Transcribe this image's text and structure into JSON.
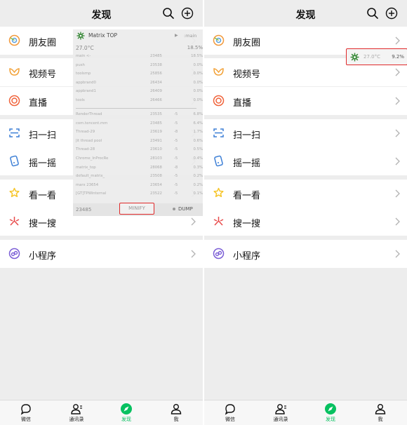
{
  "title": "发现",
  "items": [
    {
      "label": "朋友圈",
      "icon": "moments-icon",
      "color": "#f2993b"
    },
    {
      "label": "视频号",
      "icon": "channels-icon",
      "color": "#f2a137"
    },
    {
      "label": "直播",
      "icon": "live-icon",
      "color": "#f0643c"
    },
    {
      "label": "扫一扫",
      "icon": "scan-icon",
      "color": "#3d7fd6"
    },
    {
      "label": "摇一摇",
      "icon": "shake-icon",
      "color": "#3d7fd6"
    },
    {
      "label": "看一看",
      "icon": "top-stories-icon",
      "color": "#f6c52a"
    },
    {
      "label": "搜一搜",
      "icon": "search-feature-icon",
      "color": "#e84b4b"
    },
    {
      "label": "小程序",
      "icon": "mini-programs-icon",
      "color": "#7b5ed6"
    }
  ],
  "tabs": [
    {
      "label": "微信",
      "icon": "chats-icon"
    },
    {
      "label": "通讯录",
      "icon": "contacts-icon"
    },
    {
      "label": "发现",
      "icon": "discover-icon"
    },
    {
      "label": "我",
      "icon": "me-icon"
    }
  ],
  "active_tab": "发现",
  "overlay": {
    "title": "Matrix TOP",
    "process": ":main",
    "temperature": "27.0°C",
    "cpu_total": "18.5%",
    "threads": [
      {
        "name": "main <-",
        "pid": "23485",
        "nice": "",
        "cpu": "18.5%"
      },
      {
        "name": "push",
        "pid": "23538",
        "nice": "",
        "cpu": "0.0%"
      },
      {
        "name": "toolsmp",
        "pid": "25856",
        "nice": "",
        "cpu": "0.0%"
      },
      {
        "name": "appbrand0",
        "pid": "26434",
        "nice": "",
        "cpu": "0.0%"
      },
      {
        "name": "appbrand1",
        "pid": "26409",
        "nice": "",
        "cpu": "0.0%"
      },
      {
        "name": "tools",
        "pid": "26466",
        "nice": "",
        "cpu": "0.0%"
      },
      {
        "name": "RenderThread",
        "pid": "23535",
        "nice": "-5",
        "cpu": "6.8%"
      },
      {
        "name": "com.tencent.mm",
        "pid": "23485",
        "nice": "-5",
        "cpu": "6.4%"
      },
      {
        "name": "Thread-29",
        "pid": "23619",
        "nice": "-8",
        "cpu": "1.7%"
      },
      {
        "name": "Jit thread pool",
        "pid": "23491",
        "nice": "-5",
        "cpu": "0.6%"
      },
      {
        "name": "Thread-28",
        "pid": "23610",
        "nice": "-5",
        "cpu": "0.5%"
      },
      {
        "name": "Chrome_InProcRe",
        "pid": "28103",
        "nice": "-5",
        "cpu": "0.4%"
      },
      {
        "name": "matrix_top",
        "pid": "28068",
        "nice": "-8",
        "cpu": "0.3%"
      },
      {
        "name": "default_matrix_",
        "pid": "23508",
        "nice": "-5",
        "cpu": "0.2%"
      },
      {
        "name": "marx 23654",
        "pid": "23654",
        "nice": "-5",
        "cpu": "0.2%"
      },
      {
        "name": "[GT]TPWinternal",
        "pid": "23522",
        "nice": "-5",
        "cpu": "0.1%"
      }
    ],
    "footer_pid": "23485",
    "minify_label": "MINIFY",
    "dump_label": "DUMP"
  },
  "mini_widget": {
    "temperature": "27.0°C",
    "cpu": "9.2%"
  },
  "colors": {
    "accent": "#07c160",
    "highlight": "#e0292a",
    "background": "#ededed"
  }
}
